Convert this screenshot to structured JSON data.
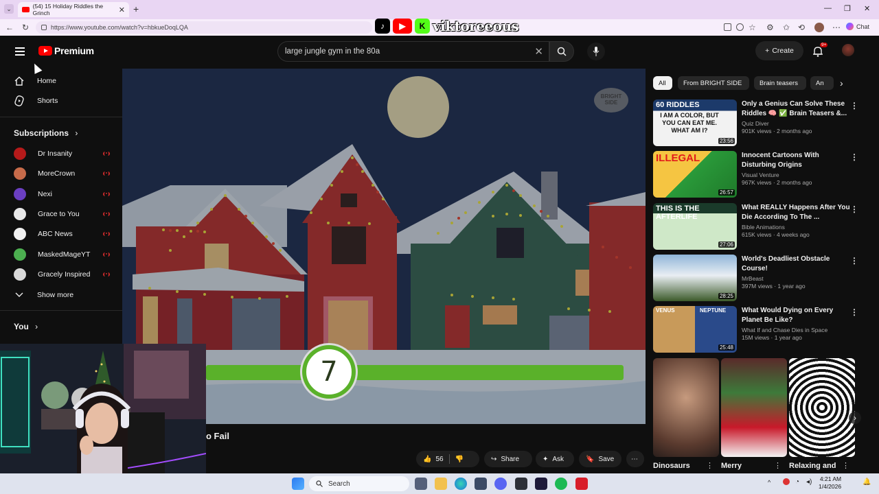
{
  "browser": {
    "tab_title": "(54) 15 Holiday Riddles the Grinch",
    "url": "https://www.youtube.com/watch?v=hbkueDoqLQA",
    "chat_label": "Chat"
  },
  "overlay": {
    "streamer_name": "viktoreeous"
  },
  "youtube": {
    "logo_label": "Premium",
    "search_value": "large jungle gym in the 80a",
    "create_label": "Create",
    "notif_count": "9+"
  },
  "sidebar": {
    "home": "Home",
    "shorts": "Shorts",
    "subscriptions_heading": "Subscriptions",
    "subscriptions": [
      {
        "name": "Dr Insanity",
        "color": "#b51a1a"
      },
      {
        "name": "MoreCrown",
        "color": "#c76b4a"
      },
      {
        "name": "Nexi",
        "color": "#6b3fc2"
      },
      {
        "name": "Grace to You",
        "color": "#e8e8e8"
      },
      {
        "name": "ABC News",
        "color": "#f1f1f1"
      },
      {
        "name": "MaskedMageYT",
        "color": "#4caf50"
      },
      {
        "name": "Gracely Inspired",
        "color": "#d9d9d9"
      }
    ],
    "show_more": "Show more",
    "you_heading": "You"
  },
  "video": {
    "watermark": "BRIGHT SIDE",
    "timer_number": "7",
    "timer_progress": 1.0,
    "title_partial": "o Fail",
    "likes": "56",
    "share": "Share",
    "ask": "Ask",
    "save": "Save"
  },
  "chips": [
    "All",
    "From BRIGHT SIDE",
    "Brain teasers",
    "An"
  ],
  "recommendations": [
    {
      "title": "Only a Genius Can Solve These Riddles 🧠 ✅ Brain Teasers &...",
      "channel": "Quiz Diver",
      "meta": "901K views · 2 months ago",
      "duration": "23:56",
      "thumb_text_1": "60 RIDDLES",
      "thumb_text_2": "I AM A COLOR, BUT YOU CAN EAT ME. WHAT AM I?"
    },
    {
      "title": "Innocent Cartoons With Disturbing Origins",
      "channel": "Visual Venture",
      "meta": "967K views · 2 months ago",
      "duration": "26:57",
      "thumb_text_1": "ILLEGAL"
    },
    {
      "title": "What REALLY Happens After You Die According To The ...",
      "channel": "Bible Animations",
      "meta": "615K views · 4 weeks ago",
      "duration": "27:06",
      "thumb_text_1": "THIS IS THE AFTERLIFE"
    },
    {
      "title": "World's Deadliest Obstacle Course!",
      "channel": "MrBeast",
      "meta": "397M views · 1 year ago",
      "duration": "28:25"
    },
    {
      "title": "What Would Dying on Every Planet Be Like?",
      "channel": "What If and Chase Dies in Space",
      "meta": "15M views · 1 year ago",
      "duration": "25:48",
      "thumb_text_1": "VENUS",
      "thumb_text_2": "NEPTUNE"
    }
  ],
  "shorts": [
    {
      "title": "Dinosaurs"
    },
    {
      "title": "Merry"
    },
    {
      "title": "Relaxing and"
    }
  ],
  "taskbar": {
    "search_label": "Search",
    "time": "4:21 AM",
    "date": "1/4/2026"
  }
}
